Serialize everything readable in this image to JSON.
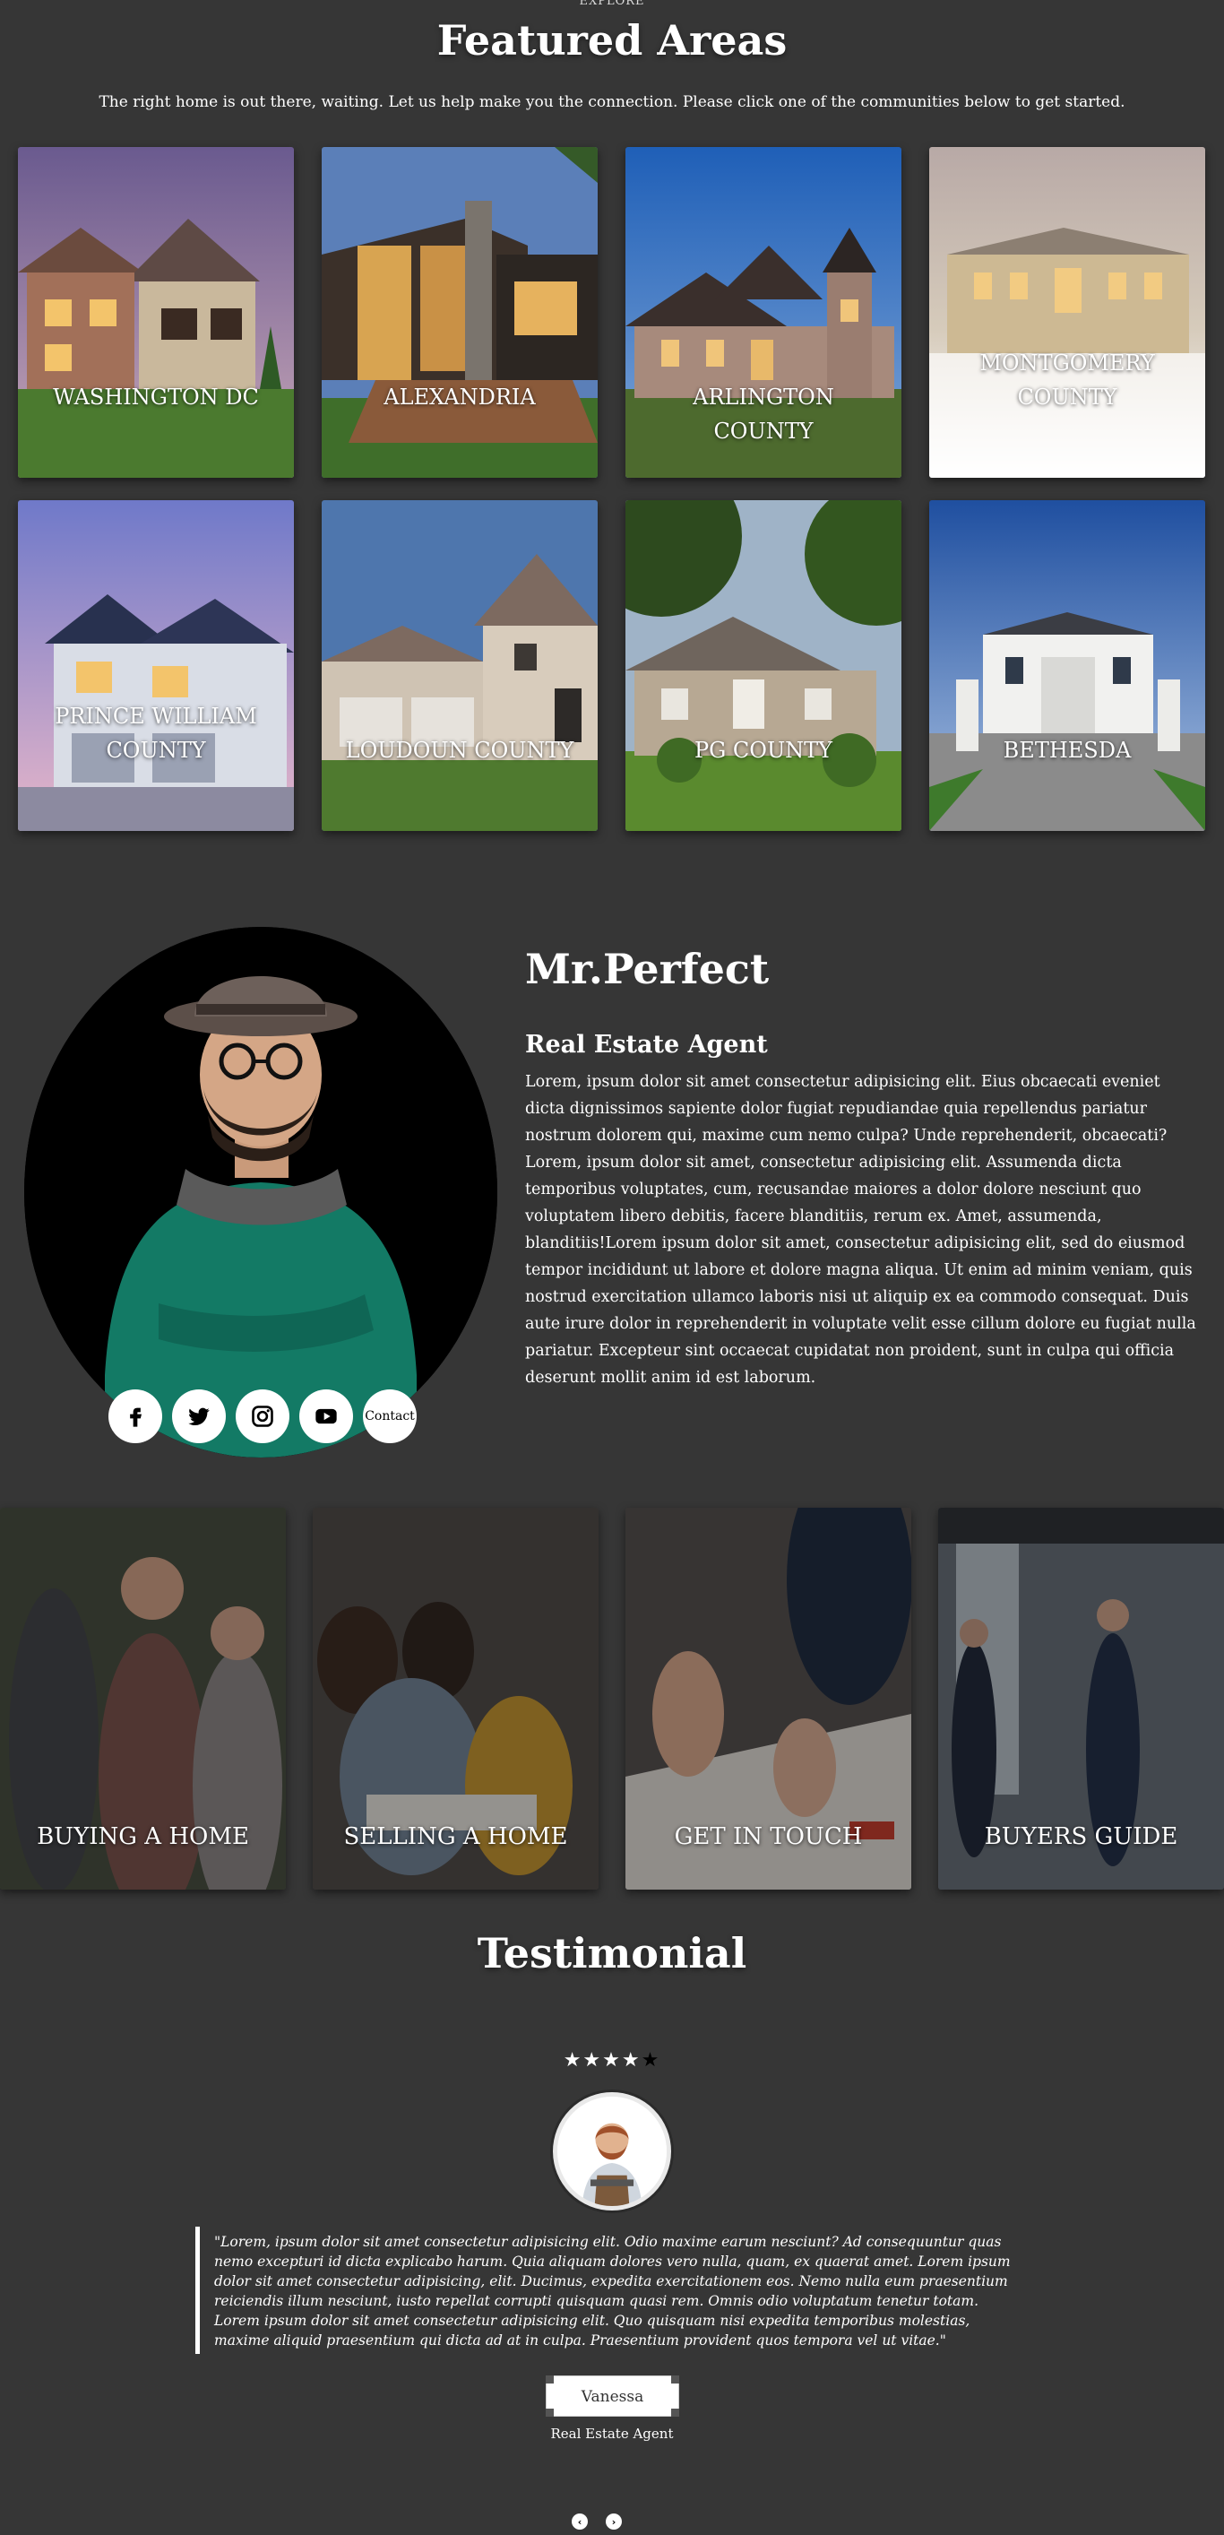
{
  "featured": {
    "eyebrow": "EXPLORE",
    "title": "Featured Areas",
    "subtitle": "The right home is out there, waiting. Let us help make you the connection. Please click one of the communities below to get started.",
    "areas": [
      {
        "label": "WASHINGTON DC"
      },
      {
        "label": "ALEXANDRIA"
      },
      {
        "label": "ARLINGTON COUNTY"
      },
      {
        "label": "MONTGOMERY COUNTY"
      },
      {
        "label": "PRINCE WILLIAM COUNTY"
      },
      {
        "label": "LOUDOUN COUNTY"
      },
      {
        "label": "PG COUNTY"
      },
      {
        "label": "BETHESDA"
      }
    ]
  },
  "agent": {
    "name": "Mr.Perfect",
    "role": "Real Estate Agent",
    "bio": "Lorem, ipsum dolor sit amet consectetur adipisicing elit. Eius obcaecati eveniet dicta dignissimos sapiente dolor fugiat repudiandae quia repellendus pariatur nostrum dolorem qui, maxime cum nemo culpa? Unde reprehenderit, obcaecati? Lorem, ipsum dolor sit amet, consectetur adipisicing elit. Assumenda dicta temporibus voluptates, cum, recusandae maiores a dolor dolore nesciunt quo voluptatem libero debitis, facere blanditiis, rerum ex. Amet, assumenda, blanditiis!Lorem ipsum dolor sit amet, consectetur adipisicing elit, sed do eiusmod tempor incididunt ut labore et dolore magna aliqua. Ut enim ad minim veniam, quis nostrud exercitation ullamco laboris nisi ut aliquip ex ea commodo consequat. Duis aute irure dolor in reprehenderit in voluptate velit esse cillum dolore eu fugiat nulla pariatur. Excepteur sint occaecat cupidatat non proident, sunt in culpa qui officia deserunt mollit anim id est laborum.",
    "social": [
      {
        "icon": "facebook-icon"
      },
      {
        "icon": "twitter-icon"
      },
      {
        "icon": "instagram-icon"
      },
      {
        "icon": "youtube-icon"
      }
    ],
    "contact_label": "Contact"
  },
  "services": [
    {
      "label": "BUYING A HOME"
    },
    {
      "label": "SELLING A HOME"
    },
    {
      "label": "GET IN TOUCH"
    },
    {
      "label": "BUYERS GUIDE"
    }
  ],
  "testimonial": {
    "title": "Testimonial",
    "rating": 4,
    "max_rating": 5,
    "star_on": "★★★★",
    "star_off": "★",
    "quote": "\"Lorem, ipsum dolor sit amet consectetur adipisicing elit. Odio maxime earum nesciunt? Ad consequuntur quas nemo excepturi id dicta explicabo harum. Quia aliquam dolores vero nulla, quam, ex quaerat amet. Lorem ipsum dolor sit amet consectetur adipisicing, elit. Ducimus, expedita exercitationem eos. Nemo nulla eum praesentium reiciendis illum nesciunt, iusto repellat corrupti quisquam quasi rem. Omnis odio voluptatum tenetur totam. Lorem ipsum dolor sit amet consectetur adipisicing elit. Quo quisquam nisi expedita temporibus molestias, maxime aliquid praesentium qui dicta ad at in culpa. Praesentium provident quos tempora vel ut vitae.\"",
    "name": "Vanessa",
    "name_role": "Real Estate Agent",
    "prev_icon": "chevron-left-icon",
    "next_icon": "chevron-right-icon",
    "prev_glyph": "‹",
    "next_glyph": "›"
  }
}
